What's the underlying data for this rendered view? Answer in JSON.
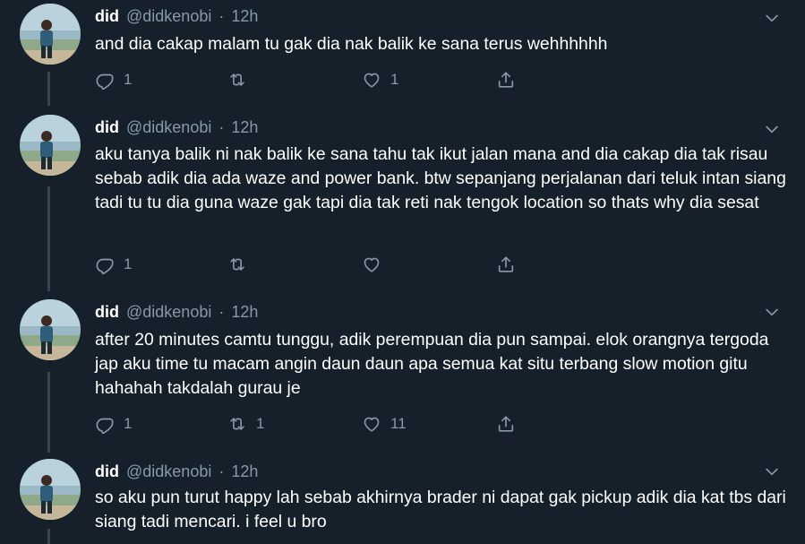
{
  "colors": {
    "background": "#15202b",
    "text": "#ffffff",
    "muted": "#8899a6",
    "thread_line": "#38444d"
  },
  "tweets": [
    {
      "name": "did",
      "handle": "@didkenobi",
      "separator": "·",
      "time": "12h",
      "text": "and dia cakap malam tu gak dia nak balik ke sana terus wehhhhhh",
      "replies": "1",
      "retweets": "",
      "likes": "1"
    },
    {
      "name": "did",
      "handle": "@didkenobi",
      "separator": "·",
      "time": "12h",
      "text": "aku tanya balik ni nak balik ke sana tahu tak ikut jalan mana and dia cakap dia tak risau sebab adik dia ada waze and power bank. btw sepanjang perjalanan dari teluk intan siang tadi tu tu dia guna waze gak tapi dia tak reti nak tengok location so thats why dia sesat",
      "replies": "1",
      "retweets": "",
      "likes": ""
    },
    {
      "name": "did",
      "handle": "@didkenobi",
      "separator": "·",
      "time": "12h",
      "text": "after 20 minutes camtu tunggu, adik perempuan dia pun sampai. elok orangnya tergoda jap aku time tu macam angin daun daun apa semua kat situ terbang slow motion gitu hahahah takdalah gurau je",
      "replies": "1",
      "retweets": "1",
      "likes": "11"
    },
    {
      "name": "did",
      "handle": "@didkenobi",
      "separator": "·",
      "time": "12h",
      "text": "so aku pun turut happy lah sebab akhirnya brader ni dapat gak pickup adik dia kat tbs dari siang tadi mencari. i feel u bro",
      "replies": "",
      "retweets": "",
      "likes": ""
    }
  ]
}
